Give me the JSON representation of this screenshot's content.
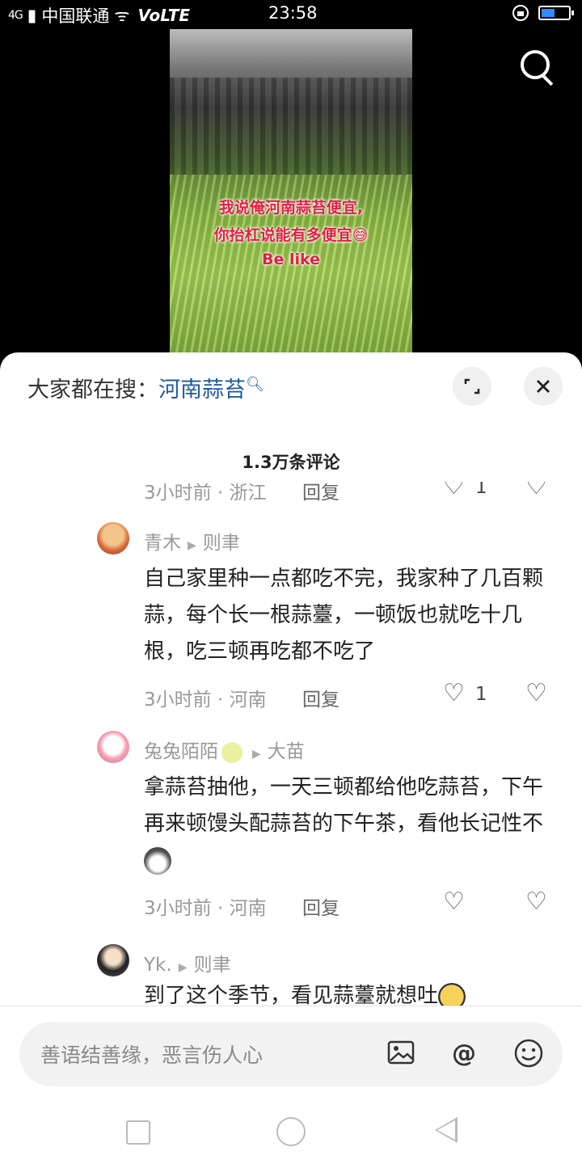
{
  "status_bar": {
    "network": "4G",
    "carrier": "中国联通",
    "volte": "VoLTE",
    "time": "23:58",
    "battery_level": 0.5
  },
  "video": {
    "caption_lines": [
      "我说俺河南蒜苔便宜,",
      "你抬杠说能有多便宜😅",
      "Be like"
    ]
  },
  "sheet": {
    "hot_search_label": "大家都在搜：",
    "hot_search_link": "河南蒜苔",
    "expand_icon": "expand-icon",
    "close_icon": "close-icon",
    "comment_count": "1.3万条评论"
  },
  "comments": [
    {
      "partial": true,
      "time_location": "3小时前 · 浙江",
      "reply": "回复",
      "likes": "1"
    },
    {
      "author": "青木",
      "reply_to": "则聿",
      "text": "自己家里种一点都吃不完，我家种了几百颗蒜，每个长一根蒜薹，一顿饭也就吃十几根，吃三顿再吃都不吃了",
      "time_location": "3小时前 · 河南",
      "reply": "回复",
      "likes": "1"
    },
    {
      "author": "兔兔陌陌",
      "reply_to": "大苗",
      "text": "拿蒜苔抽他，一天三顿都给他吃蒜苔，下午再来顿馒头配蒜苔的下午茶，看他长记性不",
      "time_location": "3小时前 · 河南",
      "reply": "回复",
      "likes": ""
    },
    {
      "author": "Yk.",
      "reply_to": "则聿",
      "text": "到了这个季节，看见蒜薹就想吐",
      "time_location": "",
      "reply": "",
      "likes": ""
    }
  ],
  "input": {
    "placeholder": "善语结善缘，恶言伤人心"
  }
}
